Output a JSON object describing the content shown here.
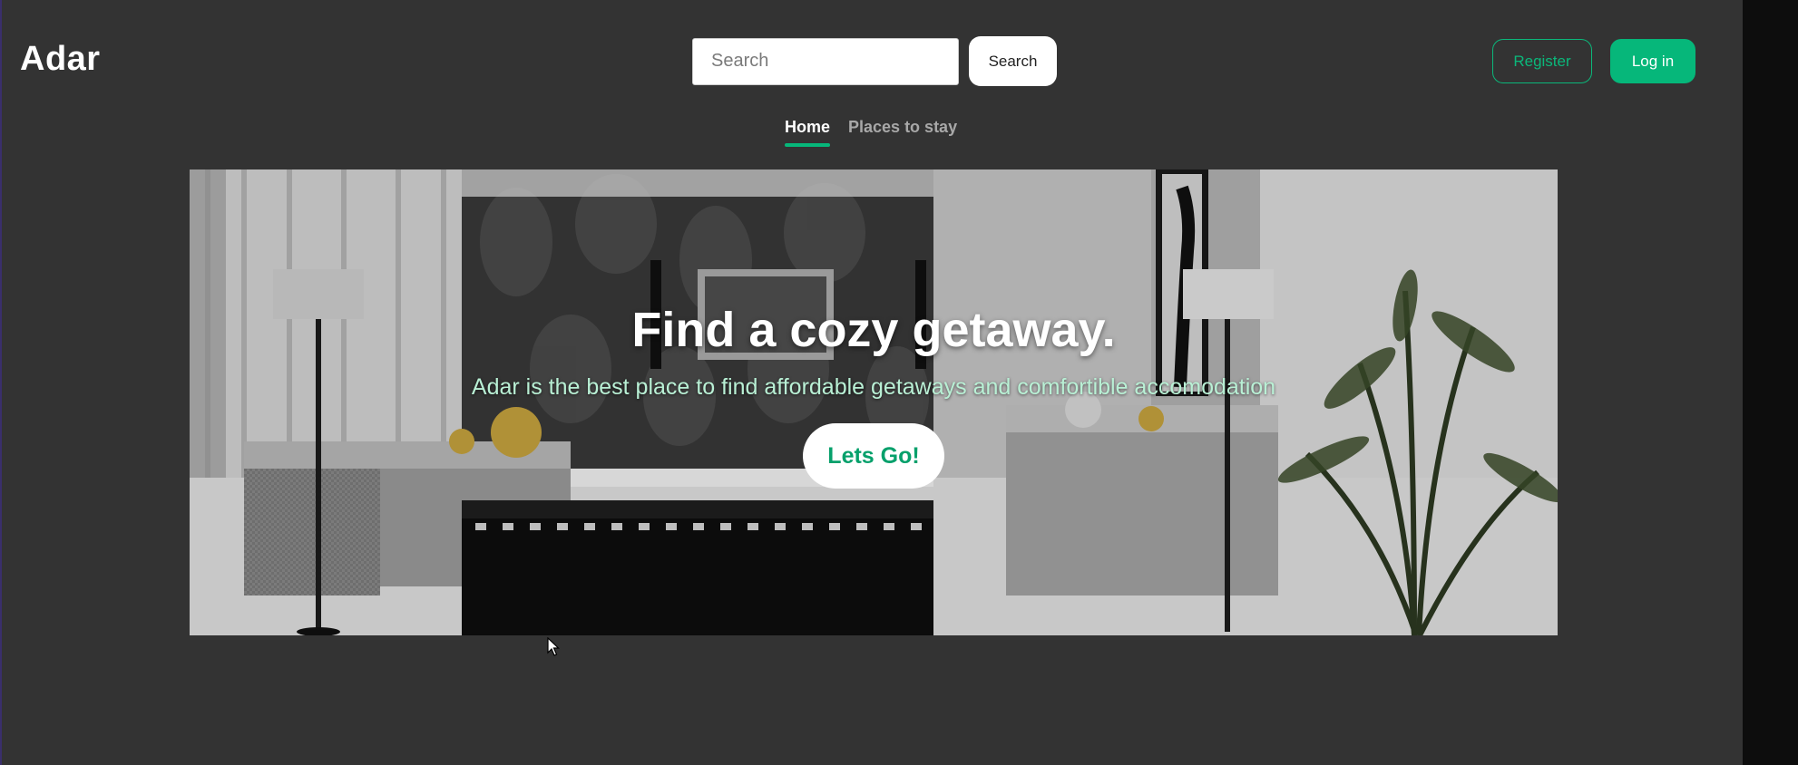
{
  "brand": {
    "logo_text": "Adar"
  },
  "header": {
    "search": {
      "placeholder": "Search",
      "value": "",
      "button_label": "Search"
    },
    "register_label": "Register",
    "login_label": "Log in"
  },
  "nav": {
    "tabs": [
      {
        "label": "Home",
        "active": true
      },
      {
        "label": "Places to stay",
        "active": false
      }
    ]
  },
  "hero": {
    "title": "Find a cozy getaway.",
    "subtitle": "Adar is the best place to find affordable getaways and comfortible accomodation",
    "cta_label": "Lets Go!"
  },
  "colors": {
    "background": "#333333",
    "accent": "#06b77a",
    "subtitle": "#b9f0d5"
  }
}
